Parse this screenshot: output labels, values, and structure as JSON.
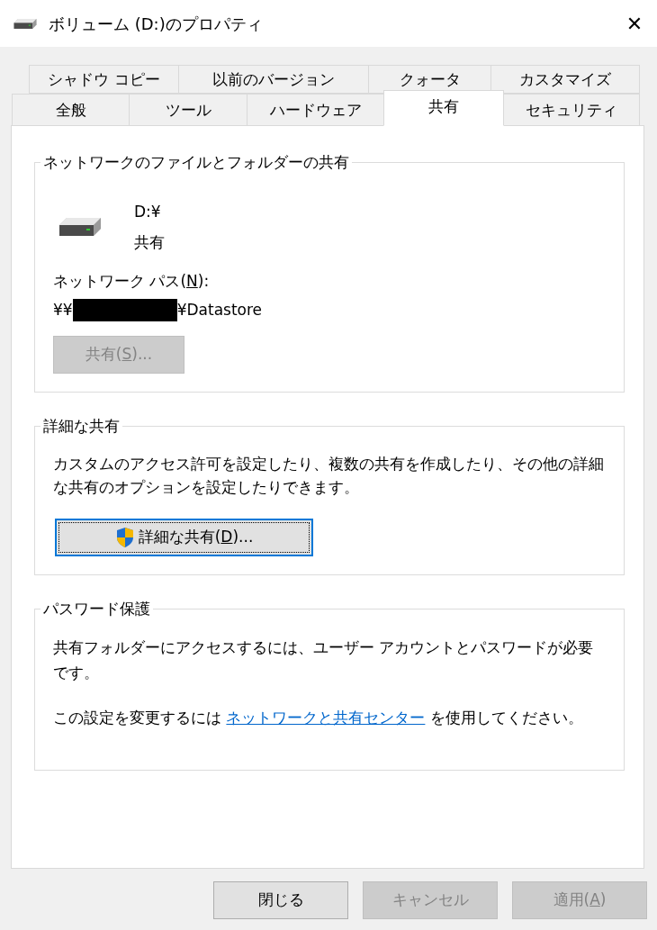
{
  "window": {
    "title": "ボリューム (D:)のプロパティ",
    "close": "✕"
  },
  "tab_rows": [
    [
      {
        "label": "シャドウ コピー",
        "selected": false
      },
      {
        "label": "以前のバージョン",
        "selected": false
      },
      {
        "label": "クォータ",
        "selected": false
      },
      {
        "label": "カスタマイズ",
        "selected": false
      }
    ],
    [
      {
        "label": "全般",
        "selected": false
      },
      {
        "label": "ツール",
        "selected": false
      },
      {
        "label": "ハードウェア",
        "selected": false
      },
      {
        "label": "共有",
        "selected": true
      },
      {
        "label": "セキュリティ",
        "selected": false
      }
    ]
  ],
  "network_sharing": {
    "title": "ネットワークのファイルとフォルダーの共有",
    "drive": "D:¥",
    "status": "共有",
    "path_label": [
      "ネットワーク パス(",
      "N",
      "):"
    ],
    "path_prefix": "¥¥",
    "path_redacted": true,
    "path_suffix": "¥Datastore",
    "share_button": {
      "label": [
        "共有(",
        "S",
        ")..."
      ],
      "disabled": true
    }
  },
  "advanced_sharing": {
    "title": "詳細な共有",
    "description": "カスタムのアクセス許可を設定したり、複数の共有を作成したり、その他の詳細な共有のオプションを設定したりできます。",
    "button": {
      "label": [
        "詳細な共有(",
        "D",
        ")..."
      ],
      "disabled": false,
      "focused": true
    }
  },
  "password_protection": {
    "title": "パスワード保護",
    "description": "共有フォルダーにアクセスするには、ユーザー アカウントとパスワードが必要です。",
    "hint_before": "この設定を変更するには ",
    "link": "ネットワークと共有センター",
    "hint_after": " を使用してください。"
  },
  "buttons": [
    {
      "label": [
        "閉じる"
      ],
      "disabled": false
    },
    {
      "label": [
        "キャンセル"
      ],
      "disabled": true
    },
    {
      "label": [
        "適用(",
        "A",
        ")"
      ],
      "disabled": true
    }
  ]
}
